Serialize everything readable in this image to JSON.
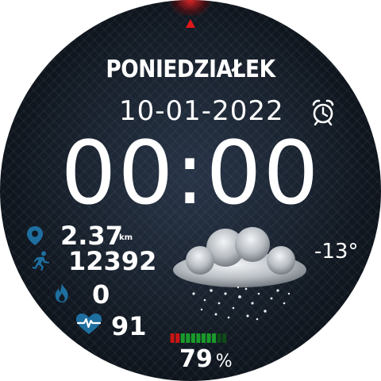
{
  "watch_face": {
    "day": "PONIEDZIAŁEK",
    "date": "10-01-2022",
    "time": "00:00",
    "distance": {
      "value": "2.37",
      "unit": "km"
    },
    "steps": "12392",
    "calories": "0",
    "heart_rate": "91",
    "temperature": "-13°",
    "battery": {
      "percent": "79",
      "percent_sign": "%",
      "level": 0.79
    }
  },
  "icons": {
    "alarm": "alarm-clock-icon",
    "distance": "location-pin-icon",
    "steps": "runner-icon",
    "calories": "flame-icon",
    "heart_rate": "heart-pulse-icon",
    "weather": "snow-cloud-icon"
  },
  "colors": {
    "accent_blue": "#1e6fa0",
    "top_marker_red": "#e01818",
    "battery_segments": [
      "#c81414",
      "#c81414",
      "#1a9a2a",
      "#1a9a2a",
      "#1a9a2a",
      "#1a9a2a",
      "#1a9a2a",
      "#1a9a2a",
      "#1a9a2a",
      "#0f4a18",
      "#0f4a18"
    ]
  }
}
